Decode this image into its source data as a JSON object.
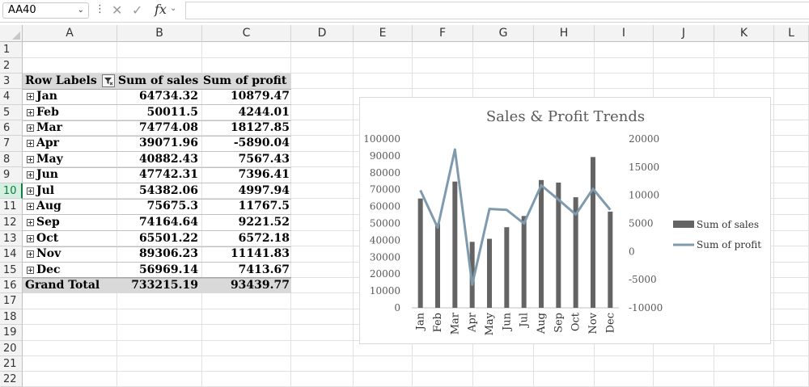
{
  "formula_bar": {
    "name_box": "AA40",
    "fx_label": "fx",
    "dots": "⋮",
    "cancel_glyph": "✕",
    "enter_glyph": "✓",
    "formula": ""
  },
  "columns": [
    "A",
    "B",
    "C",
    "D",
    "E",
    "F",
    "G",
    "H",
    "I",
    "J",
    "K",
    "L"
  ],
  "rows": [
    "1",
    "2",
    "3",
    "4",
    "5",
    "6",
    "7",
    "8",
    "9",
    "10",
    "11",
    "12",
    "13",
    "14",
    "15",
    "16",
    "17",
    "18",
    "19",
    "20",
    "21",
    "22"
  ],
  "selected_row": "10",
  "pivot": {
    "header": {
      "row_labels": "Row Labels",
      "sum_sales": "Sum of sales",
      "sum_profit": "Sum of profit"
    },
    "rows": [
      {
        "label": "Jan",
        "sales": "64734.32",
        "profit": "10879.47"
      },
      {
        "label": "Feb",
        "sales": "50011.5",
        "profit": "4244.01"
      },
      {
        "label": "Mar",
        "sales": "74774.08",
        "profit": "18127.85"
      },
      {
        "label": "Apr",
        "sales": "39071.96",
        "profit": "-5890.04"
      },
      {
        "label": "May",
        "sales": "40882.43",
        "profit": "7567.43"
      },
      {
        "label": "Jun",
        "sales": "47742.31",
        "profit": "7396.41"
      },
      {
        "label": "Jul",
        "sales": "54382.06",
        "profit": "4997.94"
      },
      {
        "label": "Aug",
        "sales": "75675.3",
        "profit": "11767.5"
      },
      {
        "label": "Sep",
        "sales": "74164.64",
        "profit": "9221.52"
      },
      {
        "label": "Oct",
        "sales": "65501.22",
        "profit": "6572.18"
      },
      {
        "label": "Nov",
        "sales": "89306.23",
        "profit": "11141.83"
      },
      {
        "label": "Dec",
        "sales": "56969.14",
        "profit": "7413.67"
      }
    ],
    "total": {
      "label": "Grand Total",
      "sales": "733215.19",
      "profit": "93439.77"
    }
  },
  "chart_data": {
    "type": "bar",
    "title": "Sales & Profit Trends",
    "categories": [
      "Jan",
      "Feb",
      "Mar",
      "Apr",
      "May",
      "Jun",
      "Jul",
      "Aug",
      "Sep",
      "Oct",
      "Nov",
      "Dec"
    ],
    "series": [
      {
        "name": "Sum of sales",
        "type": "bar",
        "axis": "left",
        "color": "#646464",
        "values": [
          64734.32,
          50011.5,
          74774.08,
          39071.96,
          40882.43,
          47742.31,
          54382.06,
          75675.3,
          74164.64,
          65501.22,
          89306.23,
          56969.14
        ]
      },
      {
        "name": "Sum of profit",
        "type": "line",
        "axis": "right",
        "color": "#7f9aad",
        "values": [
          10879.47,
          4244.01,
          18127.85,
          -5890.04,
          7567.43,
          7396.41,
          4997.94,
          11767.5,
          9221.52,
          6572.18,
          11141.83,
          7413.67
        ]
      }
    ],
    "ylim": [
      0,
      100000
    ],
    "yticks": [
      "100000",
      "90000",
      "80000",
      "70000",
      "60000",
      "50000",
      "40000",
      "30000",
      "20000",
      "10000",
      "0"
    ],
    "y2lim": [
      -10000,
      20000
    ],
    "y2ticks": [
      "20000",
      "15000",
      "10000",
      "5000",
      "0",
      "-5000",
      "-10000"
    ],
    "legend": "right",
    "grid": false
  }
}
